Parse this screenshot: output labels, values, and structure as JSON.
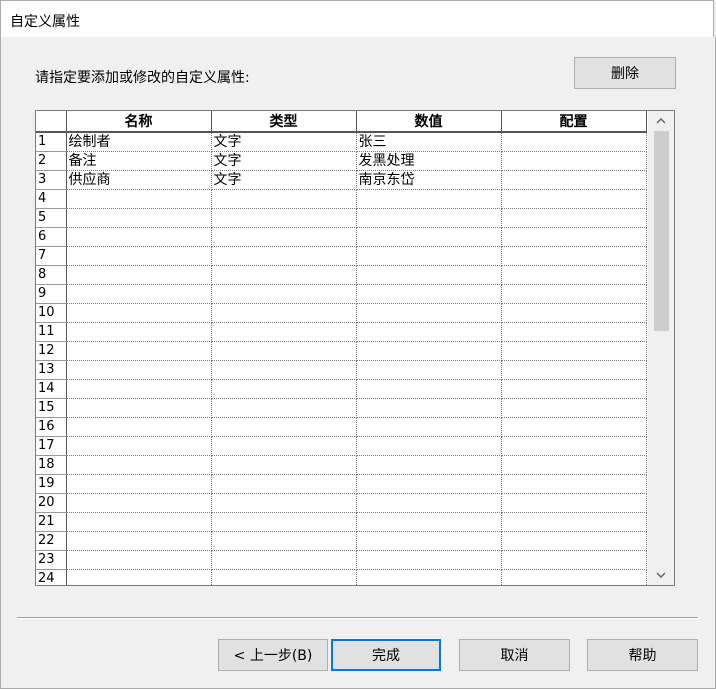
{
  "window": {
    "title": "自定义属性"
  },
  "instruction": "请指定要添加或修改的自定义属性:",
  "buttons": {
    "delete": "删除",
    "prev": "< 上一步(B)",
    "finish": "完成",
    "cancel": "取消",
    "help": "帮助"
  },
  "grid": {
    "columns": [
      "名称",
      "类型",
      "数值",
      "配置"
    ],
    "rows": [
      {
        "n": "1",
        "name": "绘制者",
        "type": "文字",
        "value": "张三",
        "config": ""
      },
      {
        "n": "2",
        "name": "备注",
        "type": "文字",
        "value": "发黑处理",
        "config": ""
      },
      {
        "n": "3",
        "name": "供应商",
        "type": "文字",
        "value": "南京东岱",
        "config": ""
      },
      {
        "n": "4",
        "name": "",
        "type": "",
        "value": "",
        "config": ""
      },
      {
        "n": "5",
        "name": "",
        "type": "",
        "value": "",
        "config": ""
      },
      {
        "n": "6",
        "name": "",
        "type": "",
        "value": "",
        "config": ""
      },
      {
        "n": "7",
        "name": "",
        "type": "",
        "value": "",
        "config": ""
      },
      {
        "n": "8",
        "name": "",
        "type": "",
        "value": "",
        "config": ""
      },
      {
        "n": "9",
        "name": "",
        "type": "",
        "value": "",
        "config": ""
      },
      {
        "n": "10",
        "name": "",
        "type": "",
        "value": "",
        "config": ""
      },
      {
        "n": "11",
        "name": "",
        "type": "",
        "value": "",
        "config": ""
      },
      {
        "n": "12",
        "name": "",
        "type": "",
        "value": "",
        "config": ""
      },
      {
        "n": "13",
        "name": "",
        "type": "",
        "value": "",
        "config": ""
      },
      {
        "n": "14",
        "name": "",
        "type": "",
        "value": "",
        "config": ""
      },
      {
        "n": "15",
        "name": "",
        "type": "",
        "value": "",
        "config": ""
      },
      {
        "n": "16",
        "name": "",
        "type": "",
        "value": "",
        "config": ""
      },
      {
        "n": "17",
        "name": "",
        "type": "",
        "value": "",
        "config": ""
      },
      {
        "n": "18",
        "name": "",
        "type": "",
        "value": "",
        "config": ""
      },
      {
        "n": "19",
        "name": "",
        "type": "",
        "value": "",
        "config": ""
      },
      {
        "n": "20",
        "name": "",
        "type": "",
        "value": "",
        "config": ""
      },
      {
        "n": "21",
        "name": "",
        "type": "",
        "value": "",
        "config": ""
      },
      {
        "n": "22",
        "name": "",
        "type": "",
        "value": "",
        "config": ""
      },
      {
        "n": "23",
        "name": "",
        "type": "",
        "value": "",
        "config": ""
      },
      {
        "n": "24",
        "name": "",
        "type": "",
        "value": "",
        "config": ""
      }
    ]
  },
  "scrollbar": {
    "up_icon": "chevron-up-icon",
    "down_icon": "chevron-down-icon"
  }
}
